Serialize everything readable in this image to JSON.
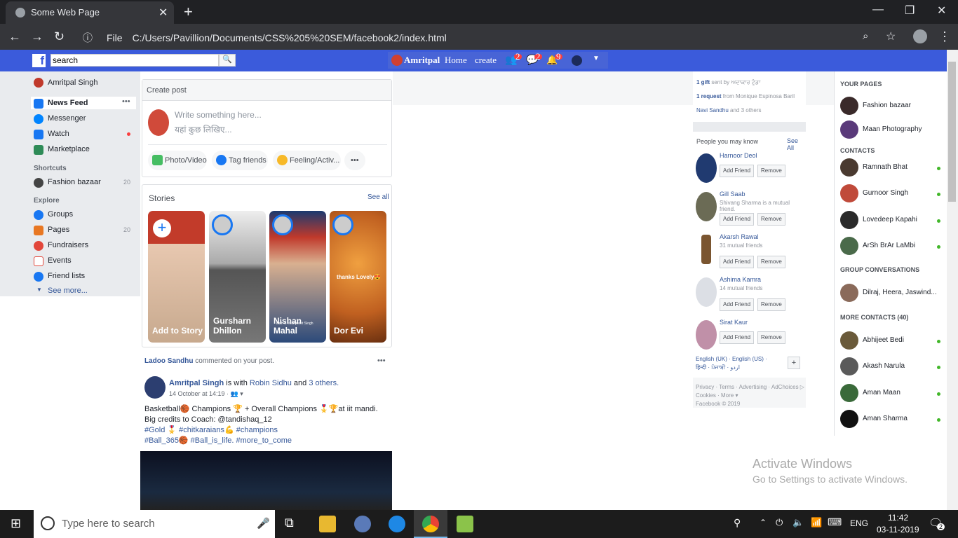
{
  "browser": {
    "tab_title": "Some Web Page",
    "tab_close": "✕",
    "new_tab": "+",
    "file_label": "File",
    "url": "C:/Users/Pavillion/Documents/CSS%205%20SEM/facebook2/index.html",
    "win_min": "—",
    "win_max": "❐",
    "win_close": "✕"
  },
  "fb_header": {
    "logo": "f",
    "search_value": "search",
    "user": "Amritpal",
    "home": "Home",
    "create": "create",
    "friend_badge": "2",
    "msg_badge": "2",
    "notif_badge": "9"
  },
  "leftnav": {
    "profile": "Amritpal Singh",
    "items": [
      {
        "label": "News Feed"
      },
      {
        "label": "Messenger"
      },
      {
        "label": "Watch"
      },
      {
        "label": "Marketplace"
      }
    ],
    "shortcuts_head": "Shortcuts",
    "shortcut": "Fashion bazaar",
    "shortcut_count": "20",
    "explore_head": "Explore",
    "explore": [
      {
        "label": "Groups"
      },
      {
        "label": "Pages",
        "count": "20"
      },
      {
        "label": "Fundraisers"
      },
      {
        "label": "Events"
      },
      {
        "label": "Friend lists"
      }
    ],
    "see_more": "See more..."
  },
  "create_post": {
    "title": "Create post",
    "placeholder1": "Write something here...",
    "placeholder2": "यहां कुछ लिखिए...",
    "photo": "Photo/Video",
    "tag": "Tag friends",
    "feeling": "Feeling/Activ...",
    "more": "•••"
  },
  "stories": {
    "title": "Stories",
    "see_all": "See all",
    "items": [
      {
        "name": "Add to Story",
        "color": "#c4a58a"
      },
      {
        "name": "Gursharn Dhillon",
        "color": "#8a8a80"
      },
      {
        "name": "Nishan Mahal",
        "color": "#3a5a8a"
      },
      {
        "name": "Dor Evi",
        "color": "#d0802a"
      }
    ],
    "overlay_text": "thanks Lovely😍",
    "badge_text": "Lath S. Manpreet Singh"
  },
  "post": {
    "notice_name": "Ladoo Sandhu",
    "notice_text": " commented on your post.",
    "author": "Amritpal Singh",
    "with_text": " is with ",
    "with_name": "Robin Sidhu",
    "and_text": " and ",
    "others": "3 others.",
    "time": "14 October at 14:19 · 👥 ▾",
    "line1": "Basketball🏀 Champions 🏆 + Overall Champions 🎖️🏆at iit mandi.",
    "line2": "Big credits to Coach: @tandishaq_12",
    "line3": "#Gold 🎖️ #chitkaraians💪 #champions",
    "line4": "#Ball_365🏀 #Ball_is_life. #more_to_come",
    "dots": "•••"
  },
  "right": {
    "gift": "1 gift",
    "gift_from": " sent by ਅਦਾਕਾਰ ਟੁੰਡਾ",
    "request": "1 request",
    "request_from": " from Monique Espinosa Baril",
    "bday_name": "Navi Sandhu",
    "bday_rest": " and 3 others",
    "pymk": "People you may know",
    "see_all": "See All",
    "people": [
      {
        "name": "Harnoor Deol",
        "meta": ""
      },
      {
        "name": "Gill Saab",
        "meta": "Shivang Sharma is a mutual friend."
      },
      {
        "name": "Akarsh Rawal",
        "meta": "31 mutual friends"
      },
      {
        "name": "Ashima Kamra",
        "meta": "14 mutual friends"
      },
      {
        "name": "Sirat Kaur",
        "meta": ""
      }
    ],
    "add_friend": "Add Friend",
    "remove": "Remove",
    "languages": "English (UK) · English (US) · हिन्दी · ਪੰਜਾਬੀ · اردو",
    "plus": "+",
    "footer1": "Privacy · Terms · Advertising · AdChoices ▷",
    "footer2": "Cookies · More ▾",
    "footer3": "Facebook © 2019"
  },
  "chat": {
    "your_pages": "YOUR PAGES",
    "pages": [
      "Fashion bazaar",
      "Maan Photography"
    ],
    "contacts_head": "CONTACTS",
    "contacts": [
      "Ramnath Bhat",
      "Gurnoor Singh",
      "Lovedeep Kapahi",
      "ArSh BrAr LaMbi"
    ],
    "group_head": "GROUP CONVERSATIONS",
    "group": "Dilraj, Heera, Jaswind...",
    "more_head": "MORE CONTACTS (40)",
    "more": [
      "Abhijeet Bedi",
      "Akash Narula",
      "Aman Maan",
      "Aman Sharma"
    ]
  },
  "watermark": {
    "line1": "Activate Windows",
    "line2": "Go to Settings to activate Windows."
  },
  "taskbar": {
    "search_placeholder": "Type here to search",
    "lang": "ENG",
    "time": "11:42",
    "date": "03-11-2019",
    "notif_count": "2"
  }
}
